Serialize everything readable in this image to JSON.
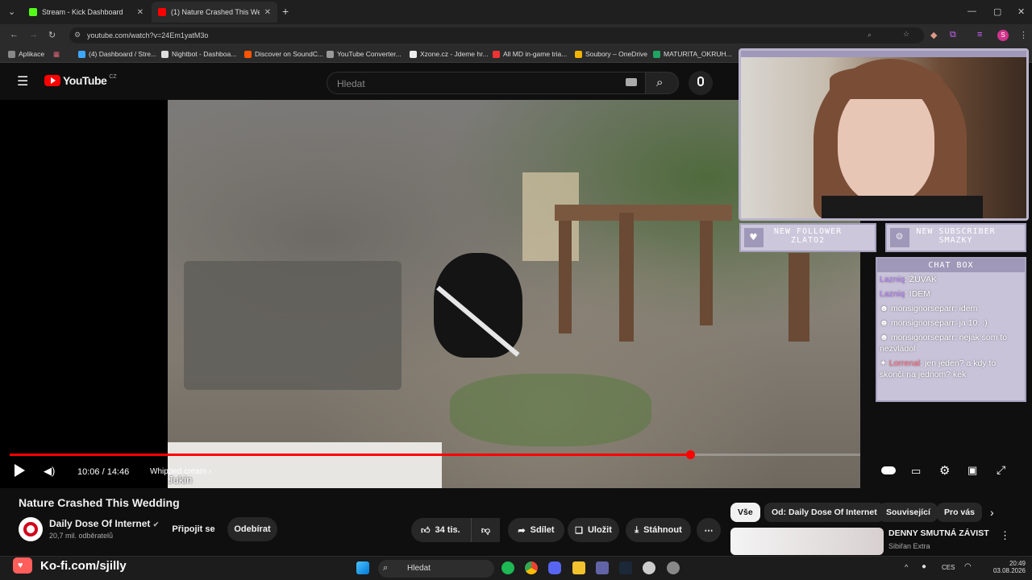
{
  "browser": {
    "tabs": [
      {
        "label": "Stream - Kick Dashboard",
        "color": "#53fc18"
      },
      {
        "label": "(1) Nature Crashed This Weddin",
        "color": "#ff0000"
      }
    ],
    "new_tab": "+",
    "url": "youtube.com/watch?v=24Em1yatM3o",
    "profile_initial": "S",
    "bookmarks": [
      {
        "label": "Aplikace",
        "color": "#888"
      },
      {
        "label": "(4) Dashboard / Stre...",
        "color": "#3ea6ff"
      },
      {
        "label": "Nightbot - Dashboa...",
        "color": "#ddd"
      },
      {
        "label": "Discover on SoundC...",
        "color": "#ff5500"
      },
      {
        "label": "YouTube Converter...",
        "color": "#999"
      },
      {
        "label": "Xzone.cz - Jdeme hr...",
        "color": "#eee"
      },
      {
        "label": "All MD in-game tria...",
        "color": "#e33"
      },
      {
        "label": "Soubory – OneDrive",
        "color": "#f2b200"
      },
      {
        "label": "MATURITA_OKRUH...",
        "color": "#1fa463"
      }
    ]
  },
  "youtube": {
    "logo_text": "YouTube",
    "region": "CZ",
    "search_placeholder": "Hledat",
    "player": {
      "current_time": "10:06 / 14:46",
      "chapter": "Whipped cream",
      "chapter_arrow": "›",
      "watermark": "Jukin",
      "progress": 0.8
    },
    "video_title": "Nature Crashed This Wedding",
    "channel": {
      "name": "Daily Dose Of Internet",
      "subscribers": "20,7 mil. odběratelů",
      "verified": "✔"
    },
    "buttons": {
      "join": "Připojit se",
      "unsubscribe": "Odebírat",
      "likes": "34 tis.",
      "share": "Sdílet",
      "save": "Uložit",
      "download": "Stáhnout",
      "more": "⋯"
    },
    "chips": [
      "Vše",
      "Od: Daily Dose Of Internet",
      "Související",
      "Pro vás"
    ],
    "recommended": {
      "title": "DENNY SMUTNÁ ZÁVIST",
      "channel": "Sibiřan Extra"
    }
  },
  "overlay": {
    "follower_label": "NEW FOLLOWER",
    "follower_name": "ZLATO2",
    "subscriber_label": "NEW SUBSCRIBER",
    "subscriber_name": "SMAZKY",
    "chat_title": "CHAT BOX",
    "chat": [
      {
        "user": "Lazniq",
        "text": ": ŽUVAK"
      },
      {
        "user": "Lazniq",
        "text": ": IDEM"
      },
      {
        "user": "monsignorseparr",
        "text": ": idem"
      },
      {
        "user": "monsignorseparr",
        "text": ": ja 10. :)"
      },
      {
        "user": "monsignorseparr",
        "text": ": nejak som to nezvládol"
      },
      {
        "user": "Lorrenal",
        "text": ": jen jeden? a kdy to skončí na jednom? kek"
      }
    ],
    "kofi": "Ko-fi.com/sjilly"
  },
  "taskbar": {
    "search": "Hledat",
    "lang": "CES",
    "time": "20:49",
    "date": "03.08.2026"
  }
}
